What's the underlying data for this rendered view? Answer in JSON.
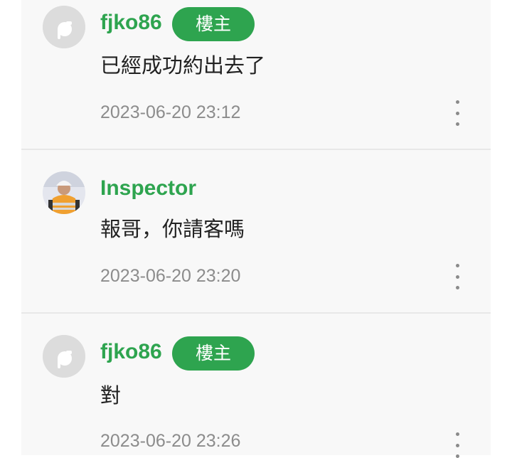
{
  "colors": {
    "username": "#2ea44f",
    "badge_bg": "#2ea44f",
    "badge_text": "#ffffff",
    "timestamp": "#8c8c8c",
    "body_text": "#222222",
    "panel_bg": "#f8f8f8"
  },
  "comments": [
    {
      "username": "fjko86",
      "badge": "樓主",
      "text": "已經成功約出去了",
      "timestamp": "2023-06-20 23:12",
      "avatar": "default-avatar-icon",
      "menu_icon": "more-vertical-icon"
    },
    {
      "username": "Inspector",
      "text": "報哥，你請客嗎",
      "timestamp": "2023-06-20 23:20",
      "avatar": "user-photo-avatar",
      "menu_icon": "more-vertical-icon"
    },
    {
      "username": "fjko86",
      "badge": "樓主",
      "text": "對",
      "timestamp": "2023-06-20 23:26",
      "avatar": "default-avatar-icon",
      "menu_icon": "more-vertical-icon"
    }
  ]
}
